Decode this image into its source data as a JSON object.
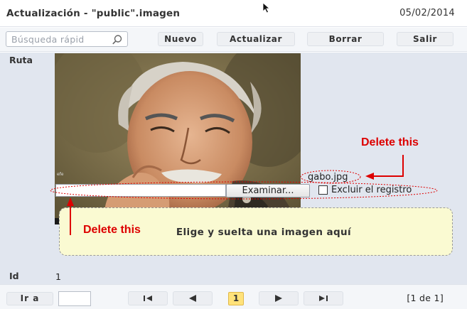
{
  "window": {
    "title": "Actualización - \"public\".imagen",
    "date": "05/02/2014"
  },
  "toolbar": {
    "search_placeholder": "Búsqueda rápid",
    "search_icon": "search-icon",
    "new_label": "Nuevo",
    "update_label": "Actualizar",
    "delete_label": "Borrar",
    "exit_label": "Salir"
  },
  "form": {
    "ruta_label": "Ruta",
    "image_caption": "efe",
    "file_name": "gabo.jpg",
    "browse_label": "Examinar...",
    "exclude_label": "Excluir el registro",
    "exclude_checked": false,
    "dropzone_text": "Elige y suelta una imagen aquí",
    "id_label": "Id",
    "id_value": "1"
  },
  "annotations": {
    "delete_top": "Delete this",
    "delete_bottom": "Delete this",
    "color": "#dd0000"
  },
  "footer": {
    "goto_label": "Ir a",
    "goto_value": "",
    "current_page": "1",
    "page_info": "[1 de 1]"
  }
}
